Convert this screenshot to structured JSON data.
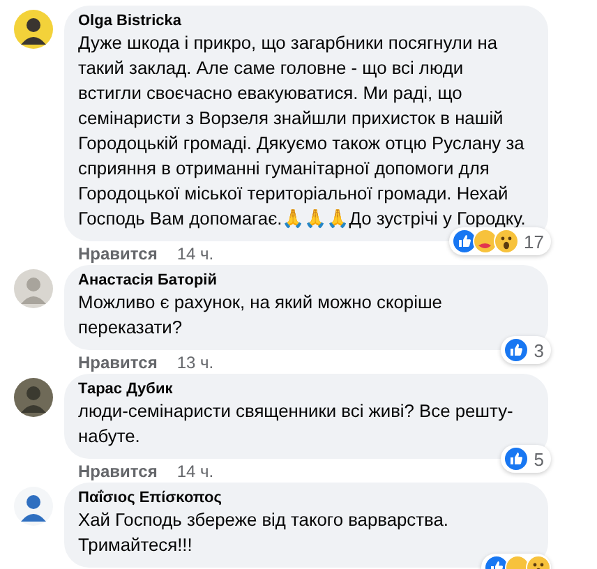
{
  "comments": [
    {
      "author": "Olga Bistricka",
      "text": "Дуже шкода і прикро, що загарбники посягнули на такий заклад. Але саме головне - що всі люди встигли своєчасно евакуюватися. Ми раді, що семінаристи з Ворзеля знайшли прихисток в нашій Городоцькій громаді. Дякуємо також отцю Руслану за сприяння в отриманні гуманітарної допомоги для Городоцької міської територіальної громади. Нехай Господь Вам допомагає.🙏🙏🙏До зустрічі у Городку.",
      "reactions": {
        "icons": [
          {
            "kind": "like"
          },
          {
            "kind": "care"
          },
          {
            "kind": "wow"
          }
        ],
        "count": "17"
      },
      "like_label": "Нравится",
      "time": "14 ч."
    },
    {
      "author": "Анастасія Баторій",
      "text": "Можливо є рахунок, на який можно скоріше переказати?",
      "reactions": {
        "icons": [
          {
            "kind": "like"
          }
        ],
        "count": "3"
      },
      "like_label": "Нравится",
      "time": "13 ч."
    },
    {
      "author": "Тарас Дубик",
      "text": "люди-семінаристи священники всі живі? Все решту-набуте.",
      "reactions": {
        "icons": [
          {
            "kind": "like"
          }
        ],
        "count": "5"
      },
      "like_label": "Нравится",
      "time": "14 ч."
    },
    {
      "author": "Παΐσιος Επίσκοπος",
      "text": "Хай Господь збереже від такого варварства. Тримайтеся!!!",
      "reactions": {
        "icons": [
          {
            "kind": "like"
          },
          {
            "kind": "care"
          },
          {
            "kind": "wow"
          }
        ]
      }
    }
  ]
}
